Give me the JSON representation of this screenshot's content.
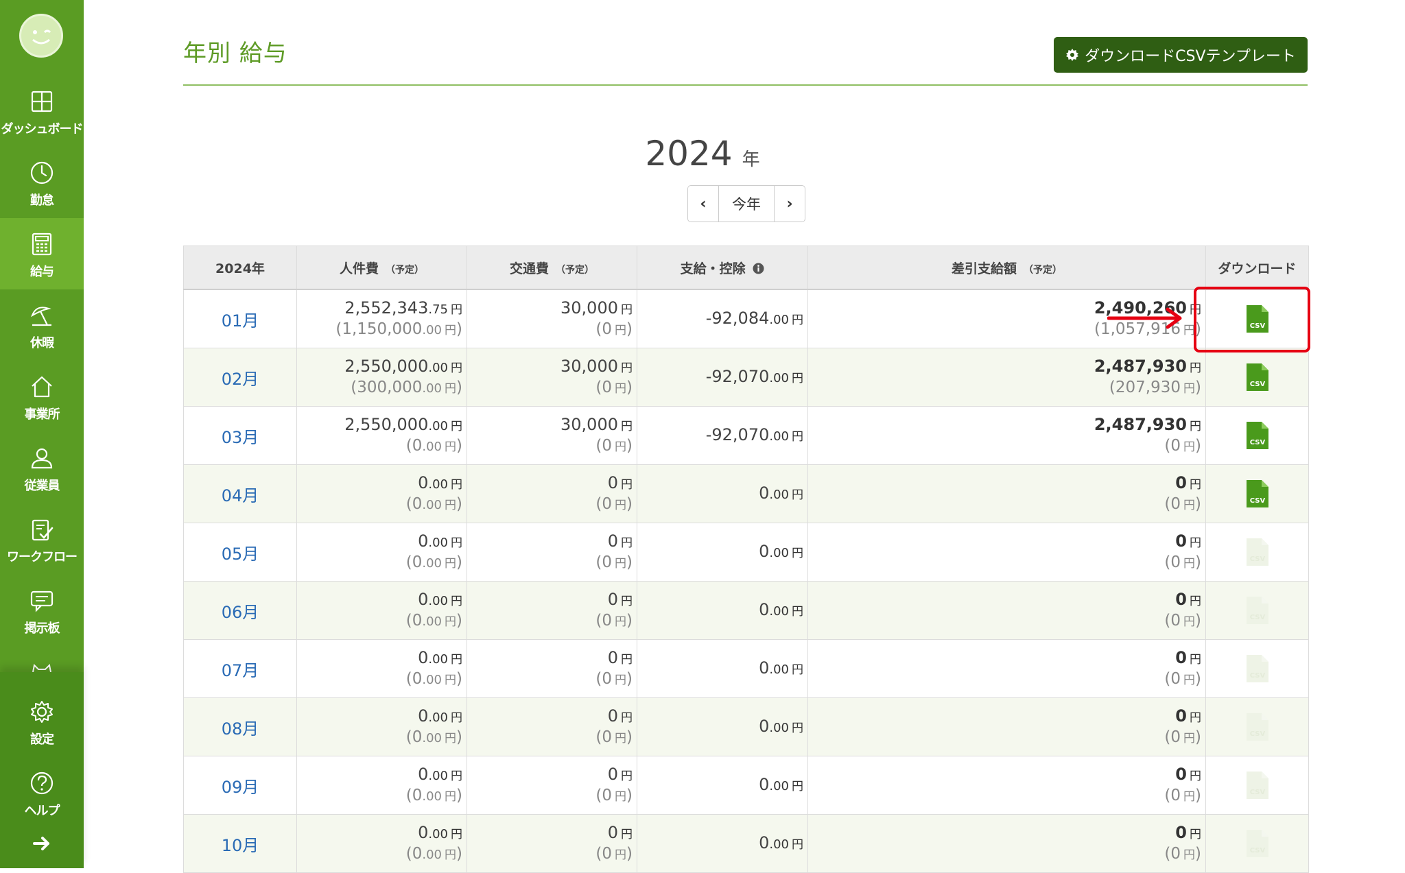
{
  "sidebar": {
    "items": [
      {
        "label": "ダッシュボード",
        "icon": "dashboard-icon",
        "active": false
      },
      {
        "label": "勤怠",
        "icon": "clock-icon",
        "active": false
      },
      {
        "label": "給与",
        "icon": "calculator-icon",
        "active": true
      },
      {
        "label": "休暇",
        "icon": "beach-umbrella-icon",
        "active": false
      },
      {
        "label": "事業所",
        "icon": "home-icon",
        "active": false
      },
      {
        "label": "従業員",
        "icon": "person-icon",
        "active": false
      },
      {
        "label": "ワークフロー",
        "icon": "clipboard-check-icon",
        "active": false
      },
      {
        "label": "掲示板",
        "icon": "chat-icon",
        "active": false
      }
    ],
    "bottom_items": [
      {
        "label": "設定",
        "icon": "gear-icon"
      },
      {
        "label": "ヘルプ",
        "icon": "help-icon"
      }
    ]
  },
  "header": {
    "title": "年別 給与",
    "template_button_label": "ダウンロードCSVテンプレート"
  },
  "year_selector": {
    "year": "2024",
    "unit": "年",
    "prev_label": "‹",
    "current_label": "今年",
    "next_label": "›"
  },
  "table": {
    "headers": {
      "month": "2024年",
      "labor": "人件費",
      "transport": "交通費",
      "deduction": "支給・控除",
      "net": "差引支給額",
      "download": "ダウンロード",
      "yotei": "（予定）"
    },
    "rows": [
      {
        "month": "01月",
        "labor_main": "2,552,343",
        "labor_main_dec": ".75",
        "labor_sub": "(1,150,000",
        "labor_sub_dec": ".00",
        "transport_main": "30,000",
        "transport_sub": "(0",
        "deduction": "-92,084",
        "deduction_dec": ".00",
        "net_main": "2,490,260",
        "net_sub": "(1,057,916",
        "csv_enabled": true
      },
      {
        "month": "02月",
        "labor_main": "2,550,000",
        "labor_main_dec": ".00",
        "labor_sub": "(300,000",
        "labor_sub_dec": ".00",
        "transport_main": "30,000",
        "transport_sub": "(0",
        "deduction": "-92,070",
        "deduction_dec": ".00",
        "net_main": "2,487,930",
        "net_sub": "(207,930",
        "csv_enabled": true
      },
      {
        "month": "03月",
        "labor_main": "2,550,000",
        "labor_main_dec": ".00",
        "labor_sub": "(0",
        "labor_sub_dec": ".00",
        "transport_main": "30,000",
        "transport_sub": "(0",
        "deduction": "-92,070",
        "deduction_dec": ".00",
        "net_main": "2,487,930",
        "net_sub": "(0",
        "csv_enabled": true
      },
      {
        "month": "04月",
        "labor_main": "0",
        "labor_main_dec": ".00",
        "labor_sub": "(0",
        "labor_sub_dec": ".00",
        "transport_main": "0",
        "transport_sub": "(0",
        "deduction": "0",
        "deduction_dec": ".00",
        "net_main": "0",
        "net_sub": "(0",
        "csv_enabled": true
      },
      {
        "month": "05月",
        "labor_main": "0",
        "labor_main_dec": ".00",
        "labor_sub": "(0",
        "labor_sub_dec": ".00",
        "transport_main": "0",
        "transport_sub": "(0",
        "deduction": "0",
        "deduction_dec": ".00",
        "net_main": "0",
        "net_sub": "(0",
        "csv_enabled": false
      },
      {
        "month": "06月",
        "labor_main": "0",
        "labor_main_dec": ".00",
        "labor_sub": "(0",
        "labor_sub_dec": ".00",
        "transport_main": "0",
        "transport_sub": "(0",
        "deduction": "0",
        "deduction_dec": ".00",
        "net_main": "0",
        "net_sub": "(0",
        "csv_enabled": false
      },
      {
        "month": "07月",
        "labor_main": "0",
        "labor_main_dec": ".00",
        "labor_sub": "(0",
        "labor_sub_dec": ".00",
        "transport_main": "0",
        "transport_sub": "(0",
        "deduction": "0",
        "deduction_dec": ".00",
        "net_main": "0",
        "net_sub": "(0",
        "csv_enabled": false
      },
      {
        "month": "08月",
        "labor_main": "0",
        "labor_main_dec": ".00",
        "labor_sub": "(0",
        "labor_sub_dec": ".00",
        "transport_main": "0",
        "transport_sub": "(0",
        "deduction": "0",
        "deduction_dec": ".00",
        "net_main": "0",
        "net_sub": "(0",
        "csv_enabled": false
      },
      {
        "month": "09月",
        "labor_main": "0",
        "labor_main_dec": ".00",
        "labor_sub": "(0",
        "labor_sub_dec": ".00",
        "transport_main": "0",
        "transport_sub": "(0",
        "deduction": "0",
        "deduction_dec": ".00",
        "net_main": "0",
        "net_sub": "(0",
        "csv_enabled": false
      },
      {
        "month": "10月",
        "labor_main": "0",
        "labor_main_dec": ".00",
        "labor_sub": "(0",
        "labor_sub_dec": ".00",
        "transport_main": "0",
        "transport_sub": "(0",
        "deduction": "0",
        "deduction_dec": ".00",
        "net_main": "0",
        "net_sub": "(0",
        "csv_enabled": false
      }
    ],
    "yen": "円",
    "close_paren": ")",
    "csv_label": "CSV"
  },
  "colors": {
    "sidebar": "#5a9c23",
    "sidebar_active": "#6fb12e",
    "accent_green": "#5e9b26",
    "dark_green_button": "#2f5e13",
    "link_blue": "#2a6bb5",
    "annotation_red": "#e60012",
    "csv_green": "#4a9a1c"
  }
}
